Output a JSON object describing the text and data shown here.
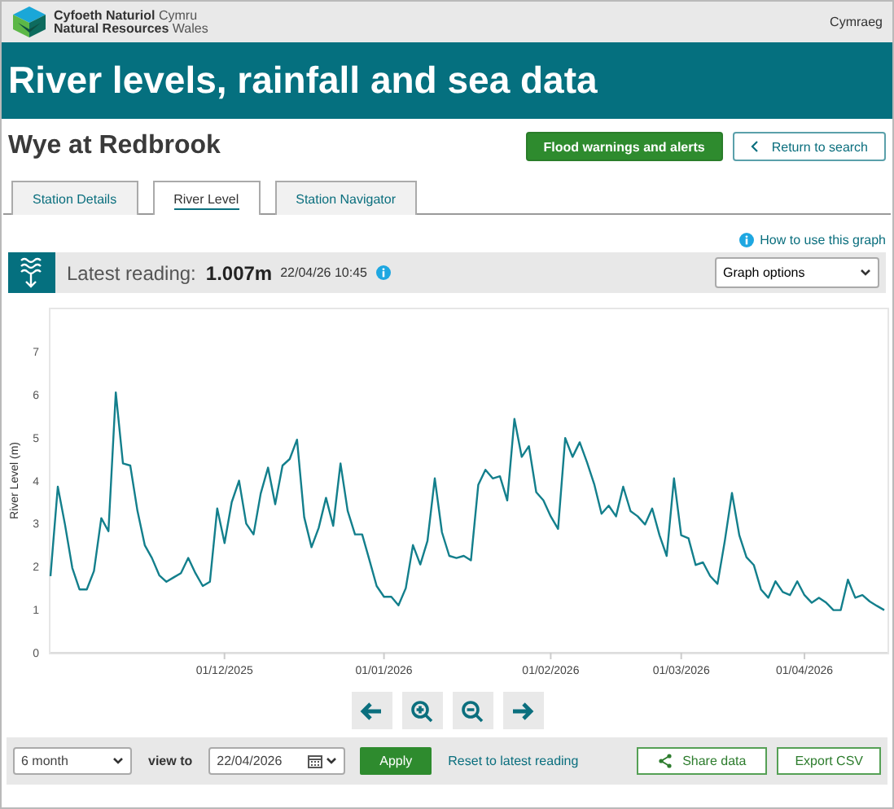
{
  "header": {
    "logo_lines": [
      "**Cyfoeth Naturiol** Cymru",
      "**Natural Resources** Wales"
    ],
    "language_link": "Cymraeg"
  },
  "banner": {
    "title": "River levels, rainfall and sea data"
  },
  "station": {
    "name": "Wye at Redbrook",
    "buttons": [
      {
        "kind": "primary",
        "label": "Flood warnings and alerts"
      },
      {
        "kind": "back",
        "label": "Return to search"
      }
    ]
  },
  "tabs": [
    {
      "label": "Station Details",
      "selected": false
    },
    {
      "label": "River Level",
      "selected": true
    },
    {
      "label": "Station Navigator",
      "selected": false
    }
  ],
  "help_link": "How to use this graph",
  "latest_reading": {
    "label": "Latest reading:",
    "value": "1.007m",
    "timestamp": "22/04/26 10:45"
  },
  "graph_options": {
    "value": "Graph options"
  },
  "chart_data": {
    "type": "line",
    "ylabel": "River Level (m)",
    "ylim": [
      0,
      8
    ],
    "yticks": [
      0,
      1,
      2,
      3,
      4,
      5,
      6,
      7
    ],
    "categories": [
      null,
      null,
      null,
      null,
      null,
      null,
      null,
      null,
      null,
      null,
      null,
      null,
      null,
      null,
      null,
      null,
      null,
      null,
      null,
      null,
      null,
      null,
      null,
      null,
      "01/12/2025",
      null,
      null,
      null,
      null,
      null,
      null,
      null,
      null,
      null,
      null,
      null,
      null,
      null,
      null,
      null,
      null,
      null,
      null,
      null,
      null,
      null,
      "01/01/2026",
      null,
      null,
      null,
      null,
      null,
      null,
      null,
      null,
      null,
      null,
      null,
      null,
      null,
      null,
      null,
      null,
      null,
      null,
      null,
      null,
      null,
      null,
      "01/02/2026",
      null,
      null,
      null,
      null,
      null,
      null,
      null,
      null,
      null,
      null,
      null,
      null,
      null,
      null,
      null,
      null,
      null,
      "01/03/2026",
      null,
      null,
      null,
      null,
      null,
      null,
      null,
      null,
      null,
      null,
      null,
      null,
      null,
      null,
      null,
      null,
      "01/04/2026",
      null,
      null,
      null,
      null,
      null,
      null,
      null,
      null,
      null,
      null,
      null
    ],
    "series": [
      {
        "color": "#137f8c",
        "values": [
          1.78,
          3.86,
          2.98,
          1.97,
          1.47,
          1.47,
          1.9,
          3.13,
          2.82,
          6.05,
          4.4,
          4.35,
          3.3,
          2.5,
          2.2,
          1.8,
          1.65,
          1.75,
          1.85,
          2.2,
          1.85,
          1.55,
          1.65,
          3.35,
          2.55,
          3.5,
          4.0,
          3.0,
          2.75,
          3.7,
          4.3,
          3.45,
          4.35,
          4.5,
          4.95,
          3.15,
          2.45,
          2.9,
          3.6,
          2.95,
          4.4,
          3.3,
          2.75,
          2.75,
          2.15,
          1.55,
          1.3,
          1.3,
          1.1,
          1.5,
          2.5,
          2.05,
          2.6,
          4.05,
          2.8,
          2.25,
          2.2,
          2.25,
          2.15,
          3.9,
          4.25,
          4.05,
          4.1,
          3.54,
          5.43,
          4.55,
          4.8,
          3.73,
          3.54,
          3.17,
          2.88,
          4.99,
          4.55,
          4.89,
          4.42,
          3.92,
          3.23,
          3.42,
          3.17,
          3.86,
          3.29,
          3.17,
          2.98,
          3.35,
          2.73,
          2.25,
          4.05,
          2.73,
          2.66,
          2.04,
          2.1,
          1.78,
          1.6,
          2.6,
          3.71,
          2.73,
          2.22,
          2.04,
          1.47,
          1.28,
          1.66,
          1.41,
          1.34,
          1.66,
          1.34,
          1.16,
          1.28,
          1.16,
          0.99,
          0.99,
          1.7,
          1.28,
          1.34,
          1.19,
          1.09,
          0.99
        ]
      }
    ]
  },
  "navigation": [
    {
      "kind": "back"
    },
    {
      "kind": "zoom_in"
    },
    {
      "kind": "zoom_out"
    },
    {
      "kind": "forward"
    }
  ],
  "controls": {
    "period": "6 month",
    "view_to_label": "view to",
    "date": "22/04/2026",
    "apply": "Apply",
    "reset_link": "Reset to latest reading",
    "share": "Share data",
    "export": "Export CSV"
  }
}
